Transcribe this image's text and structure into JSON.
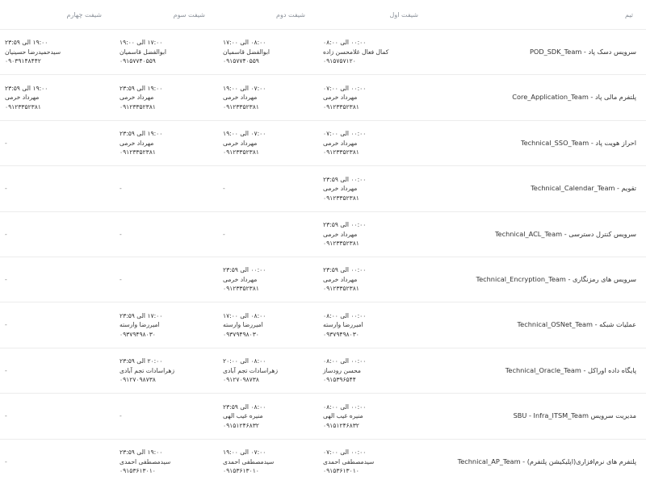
{
  "header": {
    "team": "تیم",
    "shift1": "شیفت اول",
    "shift2": "شیفت دوم",
    "shift3": "شیفت سوم",
    "shift4": "شیفت چهارم"
  },
  "rows": [
    {
      "team": "سرویس دسک پاد - POD_SDK_Team",
      "s1": {
        "time": "۰۰:۰۰ الی ۰۸:۰۰",
        "name": "کمال فعال غلامحسن زاده",
        "phone": "۰۹۱۵۷۵۷۱۲۰"
      },
      "s2": {
        "time": "۰۸:۰۰ الی ۱۷:۰۰",
        "name": "ابوالفضل قاسمیان",
        "phone": "۰۹۱۵۷۷۴۰۵۵۹"
      },
      "s3": {
        "time": "۱۷:۰۰ الی ۱۹:۰۰",
        "name": "ابوالفضل قاسمیان",
        "phone": "۰۹۱۵۷۷۴۰۵۵۹"
      },
      "s4": {
        "time": "۱۹:۰۰ الی ۲۳:۵۹",
        "name": "سیدحمیدرضا حسینیان",
        "phone": "۰۹۰۳۹۱۴۸۴۴۲"
      }
    },
    {
      "team": "پلتفرم مالی پاد - Core_Application_Team",
      "s1": {
        "time": "۰۰:۰۰ الی ۰۷:۰۰",
        "name": "مهرداد خرمی",
        "phone": "۰۹۱۲۳۳۵۲۳۸۱"
      },
      "s2": {
        "time": "۰۷:۰۰ الی ۱۹:۰۰",
        "name": "مهرداد خرمی",
        "phone": "۰۹۱۲۳۳۵۲۳۸۱"
      },
      "s3": {
        "time": "۱۹:۰۰ الی ۲۳:۵۹",
        "name": "مهرداد خرمی",
        "phone": "۰۹۱۲۳۳۵۲۳۸۱"
      },
      "s4": {
        "time": "۱۹:۰۰ الی ۲۳:۵۹",
        "name": "مهرداد خرمی",
        "phone": "۰۹۱۲۳۳۵۲۳۸۱"
      }
    },
    {
      "team": "احراز هویت پاد - Technical_SSO_Team",
      "s1": {
        "time": "۰۰:۰۰ الی ۰۷:۰۰",
        "name": "مهرداد خرمی",
        "phone": "۰۹۱۲۳۳۵۲۳۸۱"
      },
      "s2": {
        "time": "۰۷:۰۰ الی ۱۹:۰۰",
        "name": "مهرداد خرمی",
        "phone": "۰۹۱۲۳۳۵۲۳۸۱"
      },
      "s3": {
        "time": "۱۹:۰۰ الی ۲۳:۵۹",
        "name": "مهرداد خرمی",
        "phone": "۰۹۱۲۳۳۵۲۳۸۱"
      },
      "s4": "-"
    },
    {
      "team": "تقویم - Technical_Calendar_Team",
      "s1": {
        "time": "۰۰:۰۰ الی ۲۳:۵۹",
        "name": "مهرداد خرمی",
        "phone": "۰۹۱۲۳۳۵۲۳۸۱"
      },
      "s2": "-",
      "s3": "-",
      "s4": "-"
    },
    {
      "team": "سرویس کنترل دسترسی - Technical_ACL_Team",
      "s1": {
        "time": "۰۰:۰۰ الی ۲۳:۵۹",
        "name": "مهرداد خرمی",
        "phone": "۰۹۱۲۳۳۵۲۳۸۱"
      },
      "s2": "-",
      "s3": "-",
      "s4": "-"
    },
    {
      "team": "سرویس های رمزنگاری - Technical_Encryption_Team",
      "s1": {
        "time": "۰۰:۰۰ الی ۲۳:۵۹",
        "name": "مهرداد خرمی",
        "phone": "۰۹۱۲۳۳۵۲۳۸۱"
      },
      "s2": {
        "time": "۰۰:۰۰ الی ۲۳:۵۹",
        "name": "مهرداد خرمی",
        "phone": "۰۹۱۲۳۳۵۲۳۸۱"
      },
      "s3": "-",
      "s4": "-"
    },
    {
      "team": "عملیات شبکه - Technical_OSNet_Team",
      "s1": {
        "time": "۰۰:۰۰ الی ۰۸:۰۰",
        "name": "امیررضا وارسته",
        "phone": "۰۹۳۷۹۴۹۸۰۳۰"
      },
      "s2": {
        "time": "۰۸:۰۰ الی ۱۷:۰۰",
        "name": "امیررضا وارسته",
        "phone": "۰۹۳۷۹۴۹۸۰۳۰"
      },
      "s3": {
        "time": "۱۷:۰۰ الی ۲۳:۵۹",
        "name": "امیررضا وارسته",
        "phone": "۰۹۳۷۹۴۹۸۰۳۰"
      },
      "s4": "-"
    },
    {
      "team": "پایگاه داده اوراکل - Technical_Oracle_Team",
      "s1": {
        "time": "۰۰:۰۰ الی ۰۸:۰۰",
        "name": "محسن رودساز",
        "phone": "۰۹۱۵۳۹۶۵۴۴"
      },
      "s2": {
        "time": "۰۸:۰۰ الی ۲۰:۰۰",
        "name": "زهراسادات تجم آبادی",
        "phone": "۰۹۱۲۷۰۹۸۷۳۸"
      },
      "s3": {
        "time": "۲۰:۰۰ الی ۲۳:۵۹",
        "name": "زهراسادات تجم آبادی",
        "phone": "۰۹۱۲۷۰۹۸۷۳۸"
      },
      "s4": "-"
    },
    {
      "team": "مدیریت سرویس SBU - Infra_ITSM_Team",
      "s1": {
        "time": "۰۰:۰۰ الی ۰۸:۰۰",
        "name": "منیره غیب الهی",
        "phone": "۰۹۱۵۱۲۴۶۸۳۲"
      },
      "s2": {
        "time": "۰۸:۰۰ الی ۲۳:۵۹",
        "name": "منیره غیب الهی",
        "phone": "۰۹۱۵۱۲۴۶۸۳۲"
      },
      "s3": "-",
      "s4": "-"
    },
    {
      "team": "پلتفرم های نرم‌افزاری(اپلیکیشن پلتفرم) - Technical_AP_Team",
      "s1": {
        "time": "۰۰:۰۰ الی ۰۷:۰۰",
        "name": "سیدمصطفی احمدی",
        "phone": "۰۹۱۵۳۶۱۳۰۱۰"
      },
      "s2": {
        "time": "۰۷:۰۰ الی ۱۹:۰۰",
        "name": "سیدمصطفی احمدی",
        "phone": "۰۹۱۵۳۶۱۳۰۱۰"
      },
      "s3": {
        "time": "۱۹:۰۰ الی ۲۳:۵۹",
        "name": "سیدمصطفی احمدی",
        "phone": "۰۹۱۵۳۶۱۳۰۱۰"
      },
      "s4": "-"
    }
  ]
}
